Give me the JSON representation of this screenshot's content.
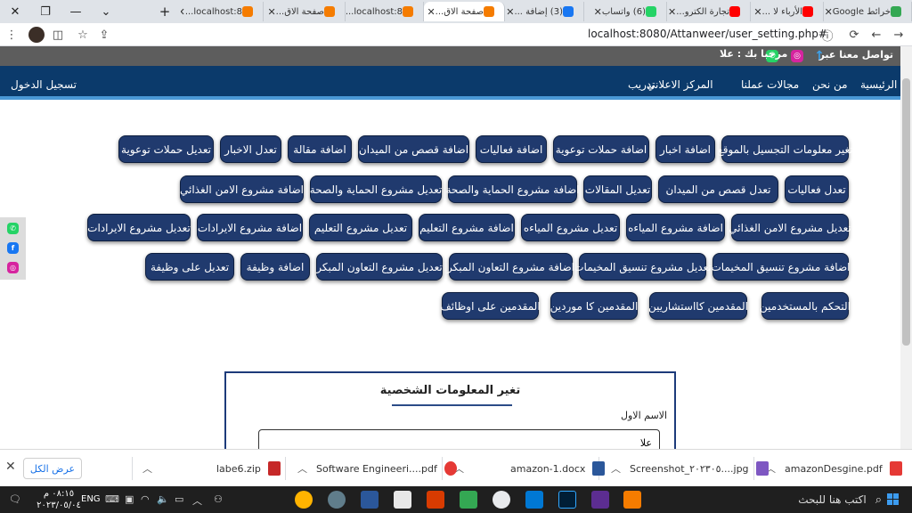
{
  "browser": {
    "tabs": [
      {
        "label": "خرائط Google",
        "favColor": "#34a853"
      },
      {
        "label": "الأرباء لا ...",
        "favColor": "#ff0000"
      },
      {
        "label": "تجارة الكترو...",
        "favColor": "#ff0000"
      },
      {
        "label": "(6) واتساب",
        "favColor": "#25d366"
      },
      {
        "label": "(3) إضافة ...",
        "favColor": "#1877f2"
      },
      {
        "label": "صفحة الاق...",
        "favColor": "#f57c00"
      },
      {
        "label": "localhost:8...",
        "favColor": "#f57c00"
      },
      {
        "label": "صفحة الاق...",
        "favColor": "#f57c00"
      },
      {
        "label": "localhost:8...",
        "favColor": "#f57c00"
      }
    ],
    "url": "localhost:8080/Attanweer/user_setting.php#"
  },
  "site": {
    "contact": "تواصل معنا عبر",
    "welcome": "مرحبا بك : علا",
    "nav": [
      "الرئيسية",
      "من نحن",
      "مجالات عملنا",
      "المركز الاعلاني",
      "تدريب"
    ],
    "login": "تسجيل الدخول"
  },
  "admin_buttons": [
    "تغير معلومات التجسيل بالموقع",
    "اضافة اخبار",
    "اضافة حملات توعوية",
    "اضافة فعاليات",
    "اضافة قصص من الميدان",
    "اضافة مقالة",
    "تعدل الاخبار",
    "تعديل حملات توعوية",
    "تعدل فعاليات",
    "تعدل قصص من الميدان",
    "تعديل المقالات",
    "اضافة مشروع الحماية والصحة",
    "تعديل مشروع الحماية والصحة",
    "اضافة مشروع الامن الغذائي",
    "تعديل مشروع الامن الغذائي",
    "اضافة مشروع المياءه",
    "تعديل مشروع المياءه",
    "اضافة مشروع التعليم",
    "تعديل مشروع التعليم",
    "اضافة مشروع الايرادات",
    "تعديل مشروع الايرادات",
    "اضافة مشروع تنسيق المخيمات",
    "تعديل مشروع تنسيق المخيمات",
    "اضافة مشروع التعاون المبكر",
    "تعديل مشروع التعاون المبكر",
    "اضافة وظيفة",
    "تعديل على وظيفة",
    "التحكم بالمستخدمين",
    "المقدمين كااستشاريين",
    "المقدمين كا موردين",
    "المقدمين على اوظائف"
  ],
  "form": {
    "title": "تغير المعلومات الشخصية",
    "first_name_label": "الاسم الاول",
    "first_name_value": "علا"
  },
  "downloads": {
    "items": [
      "amazonDesgine.pdf",
      "Screenshot_٢٠٢٣٠٥....jpg",
      "amazon-1.docx",
      "Software Engineeri....pdf",
      "labe6.zip"
    ],
    "show_all": "عرض الكل"
  },
  "taskbar": {
    "search": "اكتب هنا للبحث",
    "time": "٠٨:١٥ م",
    "date": "٢٠٢٣/٠٥/٠٤",
    "lang": "ENG"
  }
}
